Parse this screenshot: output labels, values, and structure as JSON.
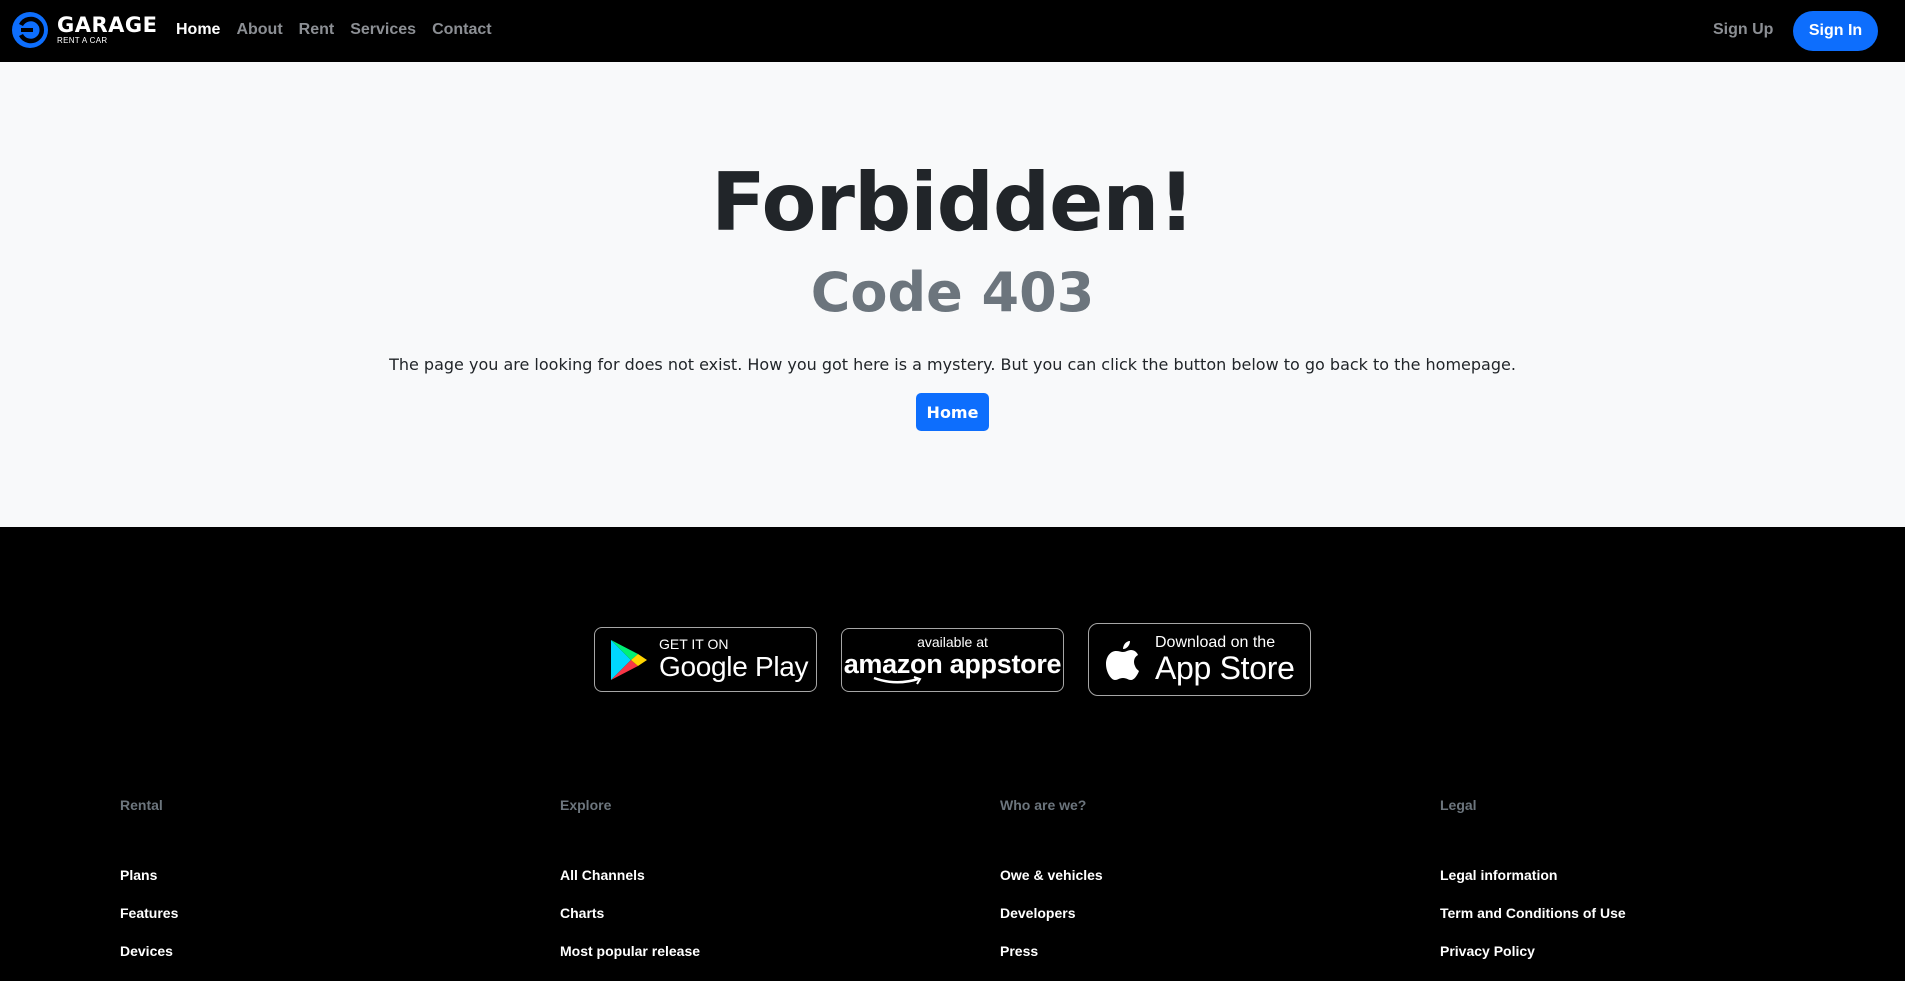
{
  "brand": {
    "name": "GARAGE",
    "tagline": "RENT A CAR",
    "accent": "#0d6efd"
  },
  "nav": {
    "links": [
      {
        "label": "Home",
        "active": true
      },
      {
        "label": "About"
      },
      {
        "label": "Rent"
      },
      {
        "label": "Services"
      },
      {
        "label": "Contact"
      }
    ],
    "signup_label": "Sign Up",
    "signin_label": "Sign In"
  },
  "error": {
    "title": "Forbidden!",
    "code": "Code 403",
    "message": "The page you are looking for does not exist. How you got here is a mystery. But you can click the button below to go back to the homepage.",
    "button_label": "Home"
  },
  "stores": {
    "google": {
      "small": "GET IT ON",
      "big": "Google Play",
      "icon": "google-play-icon"
    },
    "amazon": {
      "small": "available at",
      "big": "amazon appstore",
      "icon": "amazon-smile-icon"
    },
    "apple": {
      "small": "Download on the",
      "big": "App Store",
      "icon": "apple-icon"
    }
  },
  "footer": {
    "columns": [
      {
        "heading": "Rental",
        "items": [
          "Plans",
          "Features",
          "Devices"
        ]
      },
      {
        "heading": "Explore",
        "items": [
          "All Channels",
          "Charts",
          "Most popular release"
        ]
      },
      {
        "heading": "Who are we?",
        "items": [
          "Owe & vehicles",
          "Developers",
          "Press"
        ]
      },
      {
        "heading": "Legal",
        "items": [
          "Legal information",
          "Term and Conditions of Use",
          "Privacy Policy"
        ]
      }
    ]
  }
}
